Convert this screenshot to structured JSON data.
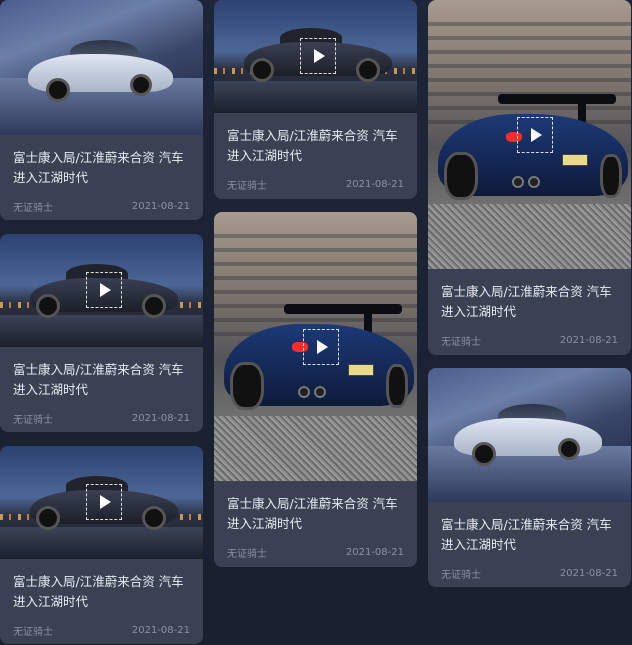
{
  "cards": [
    {
      "title": "富士康入局/江淮蔚来合资 汽车进入江湖时代",
      "author": "无证骑士",
      "date": "2021-08-21",
      "media": "image",
      "scene": "white-sedan-pier"
    },
    {
      "title": "富士康入局/江淮蔚来合资 汽车进入江湖时代",
      "author": "无证骑士",
      "date": "2021-08-21",
      "media": "video",
      "scene": "sports-car-dusk"
    },
    {
      "title": "富士康入局/江淮蔚来合资 汽车进入江湖时代",
      "author": "无证骑士",
      "date": "2021-08-21",
      "media": "video",
      "scene": "sports-car-dusk"
    },
    {
      "title": "富士康入局/江淮蔚来合资 汽车进入江湖时代",
      "author": "无证骑士",
      "date": "2021-08-21",
      "media": "video",
      "scene": "sports-car-dusk"
    },
    {
      "title": "富士康入局/江淮蔚来合资 汽车进入江湖时代",
      "author": "无证骑士",
      "date": "2021-08-21",
      "media": "video",
      "scene": "blue-wing-car-wall"
    },
    {
      "title": "富士康入局/江淮蔚来合资 汽车进入江湖时代",
      "author": "无证骑士",
      "date": "2021-08-21",
      "media": "video",
      "scene": "blue-wing-car-wall"
    },
    {
      "title": "富士康入局/江淮蔚来合资 汽车进入江湖时代",
      "author": "无证骑士",
      "date": "2021-08-21",
      "media": "image",
      "scene": "white-sedan-pier"
    }
  ],
  "icons": {
    "play": "play-icon"
  },
  "colors": {
    "background": "#1a2134",
    "card": "#3a4152",
    "title": "#e8ebf2",
    "meta": "#8b92a3"
  }
}
